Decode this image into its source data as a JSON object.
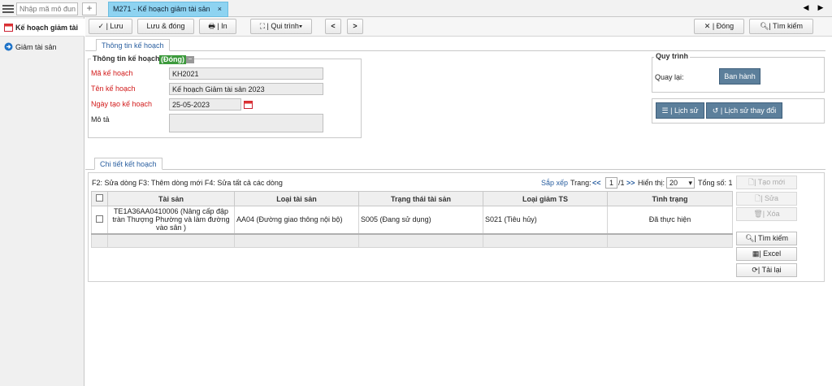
{
  "topbar": {
    "module_search_placeholder": "Nhập mã mô đun",
    "add_tab": "+",
    "active_tab": "M271 - Kế hoạch giảm tài sản",
    "tab_close": "×",
    "prev": "◀",
    "next": "▶"
  },
  "sidebar": {
    "items": [
      {
        "label": "Kế hoạch giảm tài"
      },
      {
        "label": "Giảm tài sản"
      }
    ]
  },
  "toolbar": {
    "save": "✓ | Lưu",
    "save_close": "Lưu & đóng",
    "print": "| In",
    "process": "| Qui trình",
    "back": "<",
    "forward": ">",
    "close": "✕ | Đóng",
    "search": "| Tìm kiếm"
  },
  "info": {
    "tab": "Thông tin kế hoạch",
    "legend": "Thông tin kế hoạch",
    "status": "(Đóng)",
    "collapse": "−",
    "fields": {
      "ma_label": "Mã kế hoạch",
      "ma_value": "KH2021",
      "ten_label": "Tên kế hoạch",
      "ten_value": "Kế hoạch Giảm tài sản 2023",
      "ngay_label": "Ngày tạo kế hoạch",
      "ngay_value": "25-05-2023",
      "mota_label": "Mô tả",
      "mota_value": ""
    }
  },
  "process": {
    "legend": "Quy trình",
    "back_label": "Quay lại:",
    "publish": "Ban hành",
    "history": "| Lịch sử",
    "change_history": "| Lịch sử thay đổi"
  },
  "detail": {
    "tab": "Chi tiết kết hoạch",
    "hint": "F2: Sửa dòng F3: Thêm dòng mới F4: Sửa tất cả các dòng",
    "sort": "Sắp xếp",
    "page_label": "Trang:",
    "first": "<<",
    "page": "1",
    "page_total": "/1",
    "last": ">>",
    "show_label": "Hiển thị:",
    "page_size": "20",
    "total": "Tổng số: 1",
    "columns": [
      "Tài sản",
      "Loại tài sản",
      "Trạng thái tài sản",
      "Loại giảm TS",
      "Tình trạng"
    ],
    "rows": [
      {
        "tai_san": "TE1A36AA0410006 (Nâng cấp đập tràn Thượng Phường và làm đường vào sân )",
        "loai_ts": "AA04 (Đường giao thông nội bộ)",
        "trang_thai": "S005 (Đang sử dụng)",
        "loai_giam": "S021 (Tiêu hủy)",
        "tinh_trang": "Đã thực hiện"
      }
    ]
  },
  "actions": {
    "create": "| Tạo mới",
    "edit": "| Sửa",
    "delete": "| Xóa",
    "search": "| Tìm kiếm",
    "excel": "| Excel",
    "reload": "| Tải lại"
  },
  "colors": {
    "tab_active": "#8ed3f1",
    "required_label": "#d21a1a",
    "status_badge": "#3c9a3c",
    "action_button": "#5c7f9b"
  }
}
